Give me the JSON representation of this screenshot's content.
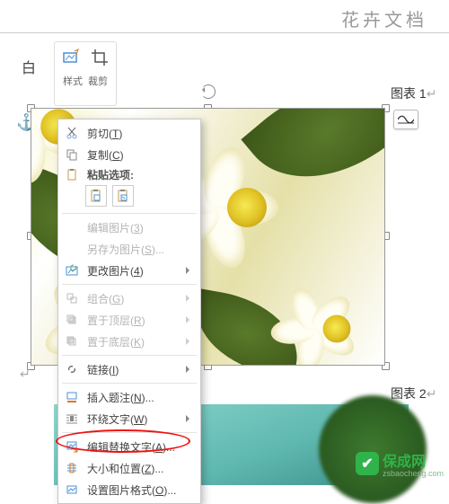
{
  "doc": {
    "title": "花卉文档"
  },
  "ribbon": {
    "tab_label_left": "白",
    "tool_style": "样式",
    "tool_crop": "裁剪"
  },
  "captions": {
    "chart1": "图表 1",
    "chart2": "图表 2"
  },
  "context_menu": {
    "cut": "剪切(T)",
    "copy": "复制(C)",
    "paste_header": "粘贴选项:",
    "edit_picture": "编辑图片(3)",
    "save_as_picture": "另存为图片(S)...",
    "change_picture": "更改图片(4)",
    "group": "组合(G)",
    "bring_to_front": "置于顶层(R)",
    "send_to_back": "置于底层(K)",
    "hyperlink": "链接(I)",
    "insert_caption": "插入题注(N)...",
    "wrap_text": "环绕文字(W)",
    "edit_alt_text": "编辑替换文字(A)...",
    "size_and_position": "大小和位置(Z)...",
    "format_picture": "设置图片格式(O)..."
  },
  "watermark": {
    "text": "保成网",
    "sub": "zsbaocheng.com"
  }
}
